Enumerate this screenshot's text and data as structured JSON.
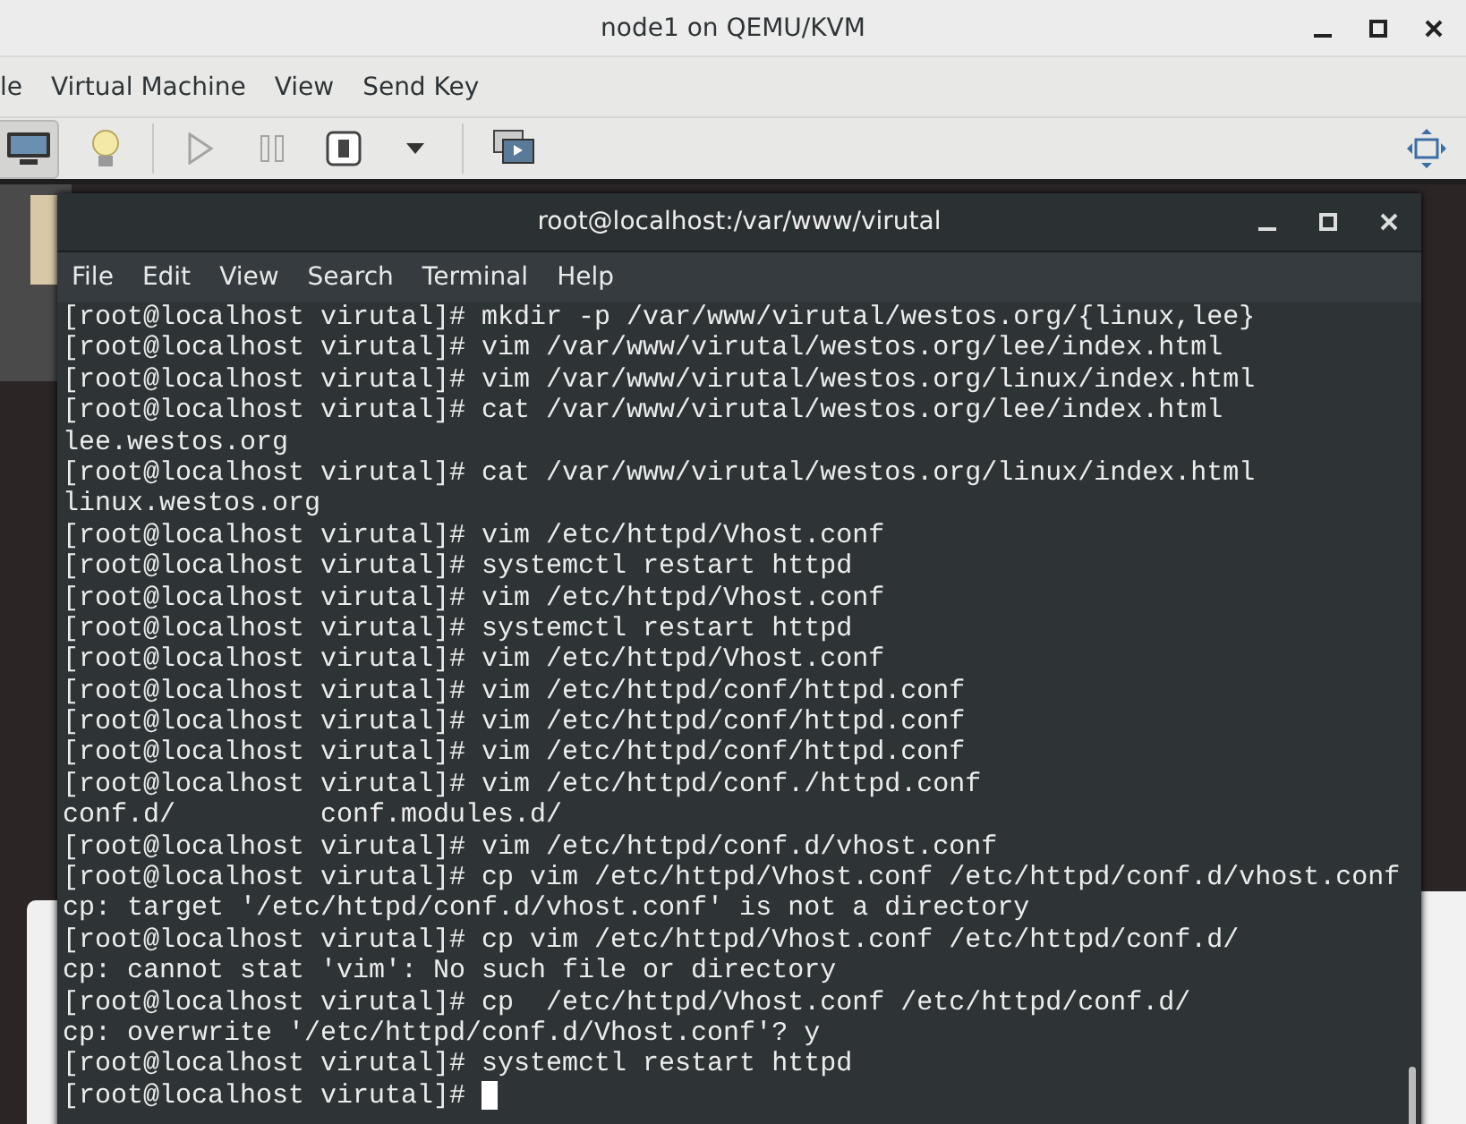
{
  "window": {
    "title": "node1 on QEMU/KVM"
  },
  "menu": [
    "le",
    "Virtual Machine",
    "View",
    "Send Key"
  ],
  "toolbar": [
    {
      "kind": "console",
      "selected": true,
      "disabled": false
    },
    {
      "kind": "details",
      "selected": false,
      "disabled": false
    },
    {
      "kind": "run",
      "selected": false,
      "disabled": true
    },
    {
      "kind": "pause",
      "selected": false,
      "disabled": true
    },
    {
      "kind": "power",
      "selected": false,
      "disabled": false
    },
    {
      "kind": "dropdown",
      "selected": false,
      "disabled": false
    },
    {
      "kind": "snapshots",
      "selected": false,
      "disabled": false
    },
    {
      "kind": "resize",
      "selected": false,
      "disabled": false
    }
  ],
  "terminal": {
    "title": "root@localhost:/var/www/virutal",
    "menu": [
      "File",
      "Edit",
      "View",
      "Search",
      "Terminal",
      "Help"
    ],
    "lines": [
      "[root@localhost virutal]# mkdir -p /var/www/virutal/westos.org/{linux,lee}",
      "[root@localhost virutal]# vim /var/www/virutal/westos.org/lee/index.html",
      "[root@localhost virutal]# vim /var/www/virutal/westos.org/linux/index.html",
      "[root@localhost virutal]# cat /var/www/virutal/westos.org/lee/index.html",
      "lee.westos.org",
      "[root@localhost virutal]# cat /var/www/virutal/westos.org/linux/index.html",
      "linux.westos.org",
      "[root@localhost virutal]# vim /etc/httpd/Vhost.conf",
      "[root@localhost virutal]# systemctl restart httpd",
      "[root@localhost virutal]# vim /etc/httpd/Vhost.conf",
      "[root@localhost virutal]# systemctl restart httpd",
      "[root@localhost virutal]# vim /etc/httpd/Vhost.conf",
      "[root@localhost virutal]# vim /etc/httpd/conf/httpd.conf",
      "[root@localhost virutal]# vim /etc/httpd/conf/httpd.conf",
      "[root@localhost virutal]# vim /etc/httpd/conf/httpd.conf",
      "[root@localhost virutal]# vim /etc/httpd/conf./httpd.conf",
      "conf.d/         conf.modules.d/",
      "[root@localhost virutal]# vim /etc/httpd/conf.d/vhost.conf",
      "[root@localhost virutal]# cp vim /etc/httpd/Vhost.conf /etc/httpd/conf.d/vhost.conf",
      "cp: target '/etc/httpd/conf.d/vhost.conf' is not a directory",
      "[root@localhost virutal]# cp vim /etc/httpd/Vhost.conf /etc/httpd/conf.d/",
      "cp: cannot stat 'vim': No such file or directory",
      "[root@localhost virutal]# cp  /etc/httpd/Vhost.conf /etc/httpd/conf.d/",
      "cp: overwrite '/etc/httpd/conf.d/Vhost.conf'? y",
      "[root@localhost virutal]# systemctl restart httpd",
      "[root@localhost virutal]# "
    ]
  }
}
